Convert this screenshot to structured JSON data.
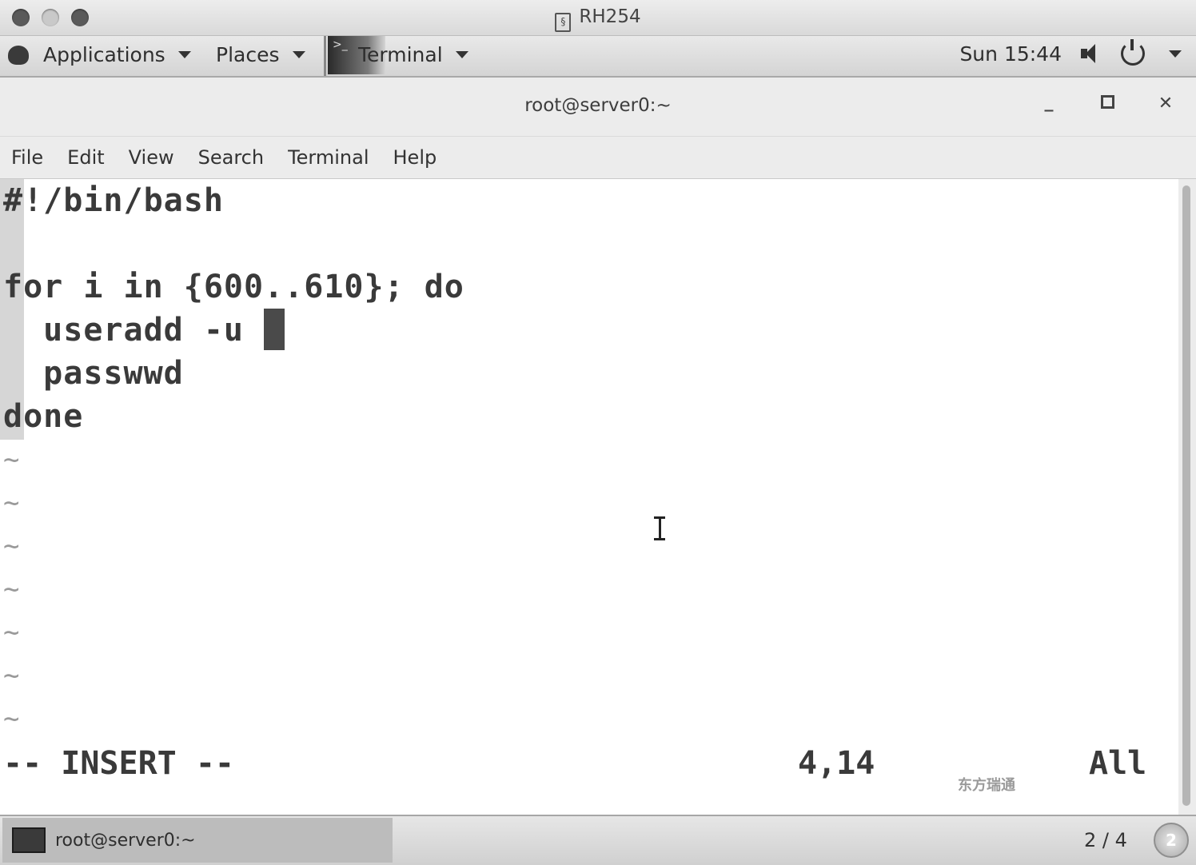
{
  "vm_window": {
    "title": "RH254"
  },
  "panel": {
    "applications_label": "Applications",
    "places_label": "Places",
    "terminal_label": "Terminal",
    "clock": "Sun 15:44"
  },
  "terminal_window": {
    "title": "root@server0:~",
    "menu": [
      "File",
      "Edit",
      "View",
      "Search",
      "Terminal",
      "Help"
    ]
  },
  "editor": {
    "lines": [
      "#!/bin/bash",
      "",
      "for i in {600..610}; do",
      "  useradd -u ",
      "  passwwd",
      "done"
    ],
    "tilde_rows": [
      "~",
      "~",
      "~",
      "~",
      "~",
      "~",
      "~"
    ],
    "mode": "-- INSERT --",
    "position": "4,14",
    "scroll": "All",
    "watermark": "东方瑞通"
  },
  "taskbar": {
    "window_label": "root@server0:~",
    "workspace": "2 / 4",
    "workspace_badge": "2"
  }
}
